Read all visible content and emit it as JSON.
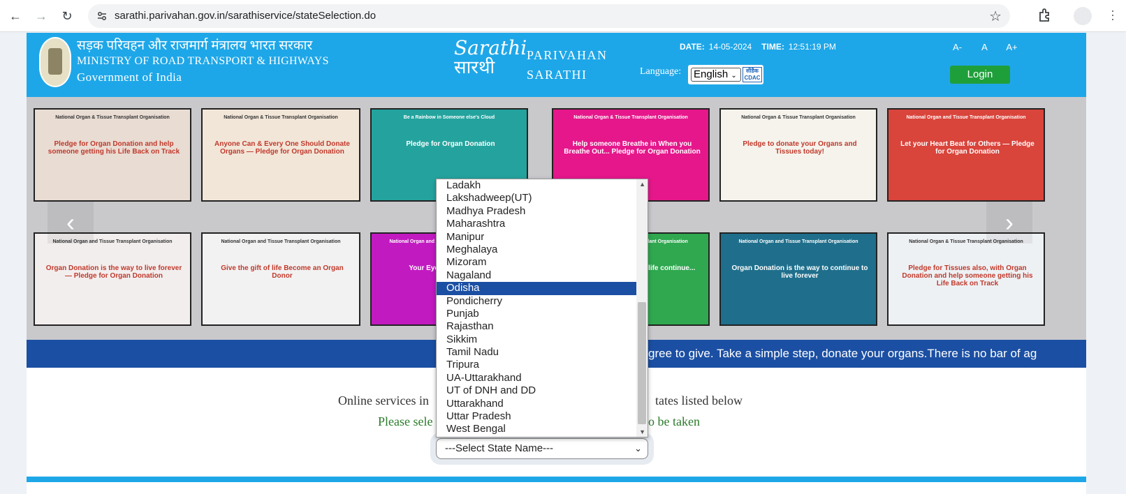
{
  "browser": {
    "url": "sarathi.parivahan.gov.in/sarathiservice/stateSelection.do"
  },
  "header": {
    "ministry_hindi": "सड़क परिवहन और राजमार्ग मंत्रालय भारत सरकार",
    "ministry_english": "MINISTRY OF ROAD TRANSPORT & HIGHWAYS",
    "government": "Government of India",
    "logo_mark": "Sarathi",
    "logo_mark_hindi": "सारथी",
    "logo_line1": "PARIVAHAN",
    "logo_line2": "SARATHI",
    "date_label": "DATE:",
    "date_value": "14-05-2024",
    "time_label": "TIME:",
    "time_value": "12:51:19 PM",
    "font_decrease": "A-",
    "font_normal": "A",
    "font_increase": "A+",
    "language_label": "Language:",
    "language_value": "English",
    "cdac_label": "सीडैक CDAC",
    "login_label": "Login"
  },
  "carousel": {
    "slides": [
      {
        "title": "National Organ & Tissue Transplant Organisation",
        "text": "Pledge for Organ Donation and help someone getting his Life Back on Track",
        "bg": "#e9dcd3"
      },
      {
        "title": "National Organ & Tissue Transplant Organisation",
        "text": "Anyone Can & Every One Should Donate Organs — Pledge for Organ Donation",
        "bg": "#f2e6d8"
      },
      {
        "title": "Be a Rainbow in Someone else's Cloud",
        "text": "Pledge for Organ Donation",
        "bg": "#24a39e"
      },
      {
        "title": "National Organ & Tissue Transplant Organisation",
        "text": "Help someone Breathe in When you Breathe Out... Pledge for Organ Donation",
        "bg": "#e5178b"
      },
      {
        "title": "National Organ & Tissue Transplant Organisation",
        "text": "Pledge to donate your Organs and Tissues today!",
        "bg": "#f5f3ec"
      },
      {
        "title": "National Organ and Tissue Transplant Organisation",
        "text": "Let your Heart Beat for Others — Pledge for Organ Donation",
        "bg": "#d9443b"
      },
      {
        "title": "National Organ and Tissue Transplant Organisation",
        "text": "Organ Donation is the way to live forever — Pledge for Organ Donation",
        "bg": "#f3eeee"
      },
      {
        "title": "National Organ and Tissue Transplant Organisation",
        "text": "Give the gift of life Become an Organ Donor",
        "bg": "#f2f2f2"
      },
      {
        "title": "National Organ and Tissue Transplant Organisation",
        "text": "Your Eyes... Pledge for ...",
        "bg": "#c21ac1"
      },
      {
        "title": "National Organ & Tissue Transplant Organisation",
        "text": "...an Organ Donor ...the life continue...",
        "bg": "#2fa84f"
      },
      {
        "title": "National Organ and Tissue Transplant Organisation",
        "text": "Organ Donation is the way to continue to live forever",
        "bg": "#1f6f8c"
      },
      {
        "title": "National Organ & Tissue Transplant Organisation",
        "text": "Pledge for Tissues also, with Organ Donation and help someone getting his Life Back on Track",
        "bg": "#eef1f4"
      }
    ]
  },
  "ticker": {
    "text": "gree to give. Take a simple step, donate your organs.There is no bar of ag"
  },
  "info": {
    "line1_left": "Online services in",
    "line1_right": "tates listed below",
    "line2_left": "Please sele",
    "line2_right": "o be taken"
  },
  "state_select": {
    "value": "---Select State Name---",
    "options": [
      "Ladakh",
      "Lakshadweep(UT)",
      "Madhya Pradesh",
      "Maharashtra",
      "Manipur",
      "Meghalaya",
      "Mizoram",
      "Nagaland",
      "Odisha",
      "Pondicherry",
      "Punjab",
      "Rajasthan",
      "Sikkim",
      "Tamil Nadu",
      "Tripura",
      "UA-Uttarakhand",
      "UT of DNH and DD",
      "Uttarakhand",
      "Uttar Pradesh",
      "West Bengal"
    ],
    "highlighted": "Odisha"
  }
}
